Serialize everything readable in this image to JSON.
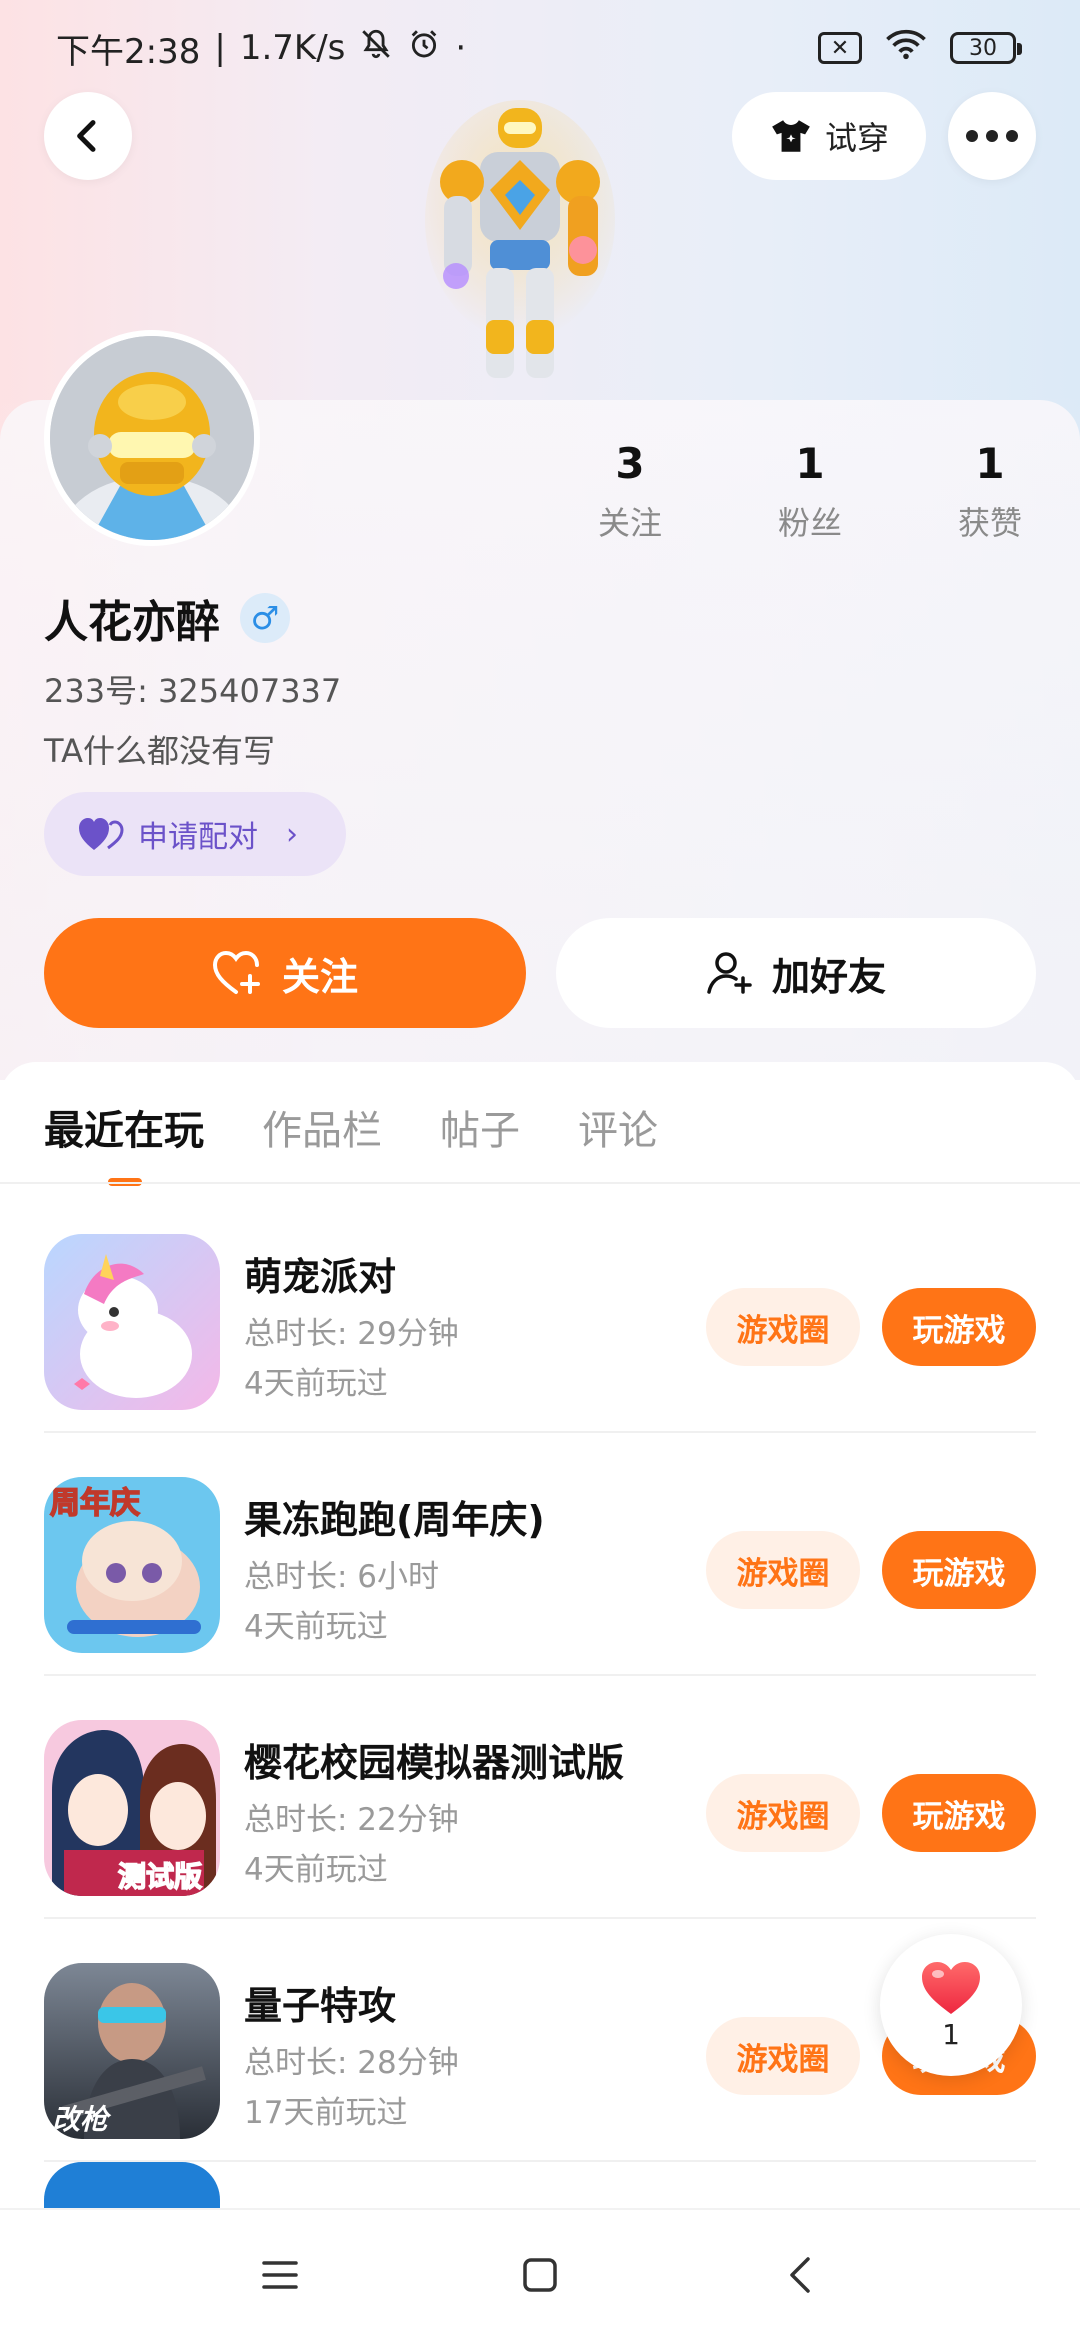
{
  "status_bar": {
    "time": "下午2:38",
    "separator": "|",
    "net_speed": "1.7K/s",
    "dot": "·",
    "battery": "30",
    "sim_x": "✕",
    "icons": [
      "mute-icon",
      "alarm-icon",
      "sim-x-icon",
      "wifi-icon",
      "battery-icon"
    ]
  },
  "header": {
    "back_icon": "chevron-left-icon",
    "try_on_label": "试穿",
    "try_on_icon": "shirt-icon",
    "more_icon": "more-dots-icon"
  },
  "profile": {
    "stats": [
      {
        "value": "3",
        "label": "关注"
      },
      {
        "value": "1",
        "label": "粉丝"
      },
      {
        "value": "1",
        "label": "获赞"
      }
    ],
    "name": "人花亦醉",
    "gender_symbol": "♂",
    "uid": "233号: 325407337",
    "bio": "TA什么都没有写",
    "pair_label": "申请配对",
    "pair_chevron": "›",
    "follow_label": "关注",
    "add_friend_label": "加好友"
  },
  "tabs": [
    {
      "label": "最近在玩",
      "active": true
    },
    {
      "label": "作品栏",
      "active": false
    },
    {
      "label": "帖子",
      "active": false
    },
    {
      "label": "评论",
      "active": false
    }
  ],
  "games": [
    {
      "name": "萌宠派对",
      "duration": "总时长: 29分钟",
      "last_played": "4天前玩过",
      "circle_label": "游戏圈",
      "play_label": "玩游戏"
    },
    {
      "name": "果冻跑跑(周年庆)",
      "duration": "总时长: 6小时",
      "last_played": "4天前玩过",
      "circle_label": "游戏圈",
      "play_label": "玩游戏",
      "icon_text": "周年庆"
    },
    {
      "name": "樱花校园模拟器测试版",
      "duration": "总时长: 22分钟",
      "last_played": "4天前玩过",
      "circle_label": "游戏圈",
      "play_label": "玩游戏",
      "icon_text": "测试版"
    },
    {
      "name": "量子特攻",
      "duration": "总时长: 28分钟",
      "last_played": "17天前玩过",
      "circle_label": "游戏圈",
      "play_label": "玩游戏",
      "icon_text": "改枪"
    }
  ],
  "like_fab": {
    "count": "1"
  },
  "colors": {
    "accent": "#ff7416",
    "pair_purple": "#6b52c9",
    "gender_blue": "#2b8ee6"
  }
}
